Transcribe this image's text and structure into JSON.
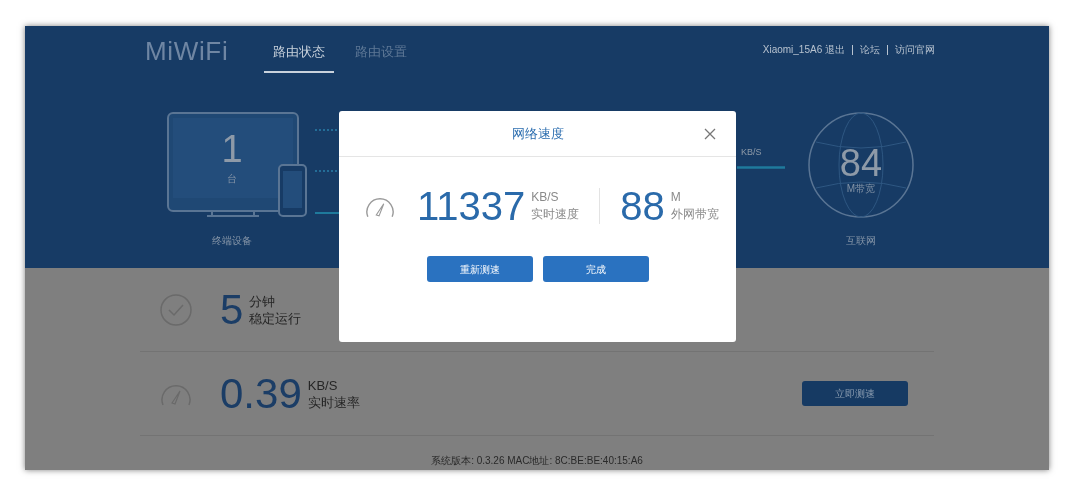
{
  "logo": "MiWiFi",
  "nav_tabs": [
    {
      "label": "路由状态",
      "selected": true
    },
    {
      "label": "路由设置",
      "selected": false
    }
  ],
  "top_links": [
    "Xiaomi_15A6 退出",
    "论坛",
    "访问官网"
  ],
  "devices": {
    "count": "1",
    "unit": "台",
    "label": "终端设备"
  },
  "speed": {
    "unit": "KB/S"
  },
  "internet": {
    "bandwidth": "84",
    "unit": "M带宽",
    "label": "互联网"
  },
  "stats": [
    {
      "kind": "uptime",
      "value": "5",
      "unit": "分钟",
      "label": "稳定运行"
    },
    {
      "kind": "speed",
      "value": "0.39",
      "unit": "KB/S",
      "label": "实时速率",
      "button": "立即测速"
    }
  ],
  "footer": "系统版本: 0.3.26 MAC地址: 8C:BE:BE:40:15:A6",
  "dialog": {
    "title": "网络速度",
    "readings": [
      {
        "value": "11337",
        "unit": "KB/S",
        "label": "实时速度"
      },
      {
        "value": "88",
        "unit": "M",
        "label": "外网带宽"
      }
    ],
    "buttons": [
      "重新测速",
      "完成"
    ]
  }
}
